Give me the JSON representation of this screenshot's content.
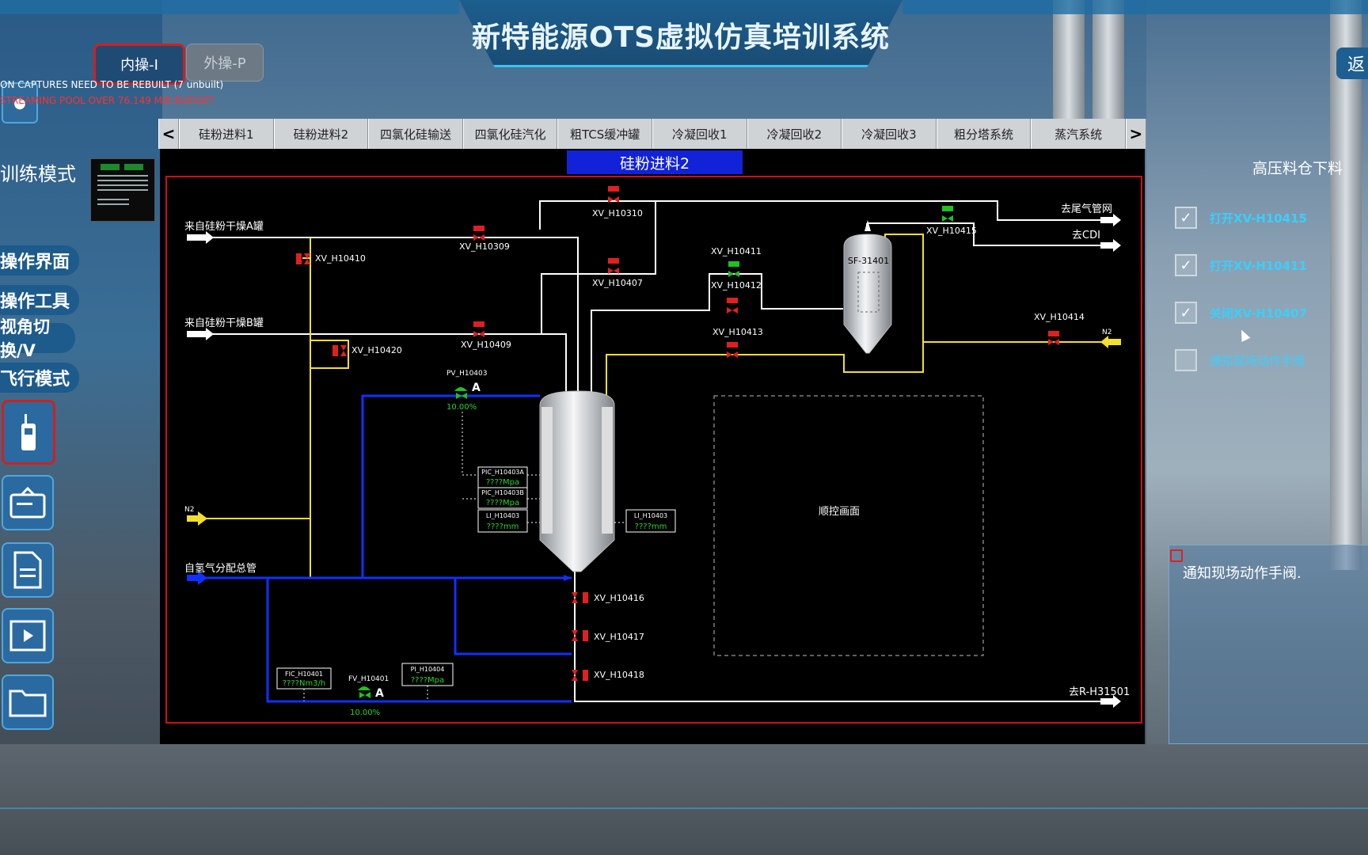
{
  "app": {
    "title": "新特能源OTS虚拟仿真培训系统"
  },
  "mode_tabs": {
    "inner": "内操-I",
    "outer": "外操-P"
  },
  "debug": {
    "line1": "ON CAPTURES NEED TO BE REBUILT (7 unbuilt)",
    "line2": "STREAMING POOL OVER 76.149 MiB BUDGET"
  },
  "left_menu": {
    "training_mode": "训练模式",
    "items": [
      "操作界面",
      "操作工具",
      "视角切换/V",
      "飞行模式"
    ],
    "icons": [
      "walkie-talkie-icon",
      "briefcase-icon",
      "document-icon",
      "video-icon",
      "folder-icon"
    ]
  },
  "tabs": {
    "prev": "<",
    "next": ">",
    "items": [
      "硅粉进料1",
      "硅粉进料2",
      "四氯化硅输送",
      "四氯化硅汽化",
      "粗TCS缓冲罐",
      "冷凝回收1",
      "冷凝回收2",
      "冷凝回收3",
      "粗分塔系统",
      "蒸汽系统"
    ]
  },
  "dcs": {
    "title": "硅粉进料2",
    "sources": {
      "dryer_a": "来自硅粉干燥A罐",
      "dryer_b": "来自硅粉干燥B罐",
      "n2_left": "N2",
      "n2_right": "N2",
      "hydrogen": "自氢气分配总管"
    },
    "destinations": {
      "tail_gas": "去尾气管网",
      "cdi": "去CDI",
      "r_h31501": "去R-H31501"
    },
    "valves": {
      "h10310": "XV_H10310",
      "h10309": "XV_H10309",
      "h10410": "XV_H10410",
      "h10407": "XV_H10407",
      "h10411": "XV_H10411",
      "h10412": "XV_H10412",
      "h10413": "XV_H10413",
      "h10415": "XV_H10415",
      "h10414": "XV_H10414",
      "h10409": "XV_H10409",
      "h10420": "XV_H10420",
      "h10416": "XV_H10416",
      "h10417": "XV_H10417",
      "h10418": "XV_H10418"
    },
    "control_valves": {
      "pv": {
        "tag": "PV_H10403",
        "mode": "A",
        "value": "10.00%"
      },
      "fv": {
        "tag": "FV_H10401",
        "mode": "A",
        "value": "10.00%"
      }
    },
    "filter": "SF-31401",
    "instruments": {
      "pic_a": {
        "tag": "PIC_H10403A",
        "value": "????Mpa"
      },
      "pic_b": {
        "tag": "PIC_H10403B",
        "value": "????Mpa"
      },
      "li_left": {
        "tag": "LI_H10403",
        "value": "????mm"
      },
      "li_right": {
        "tag": "LI_H10403",
        "value": "????mm"
      },
      "fic": {
        "tag": "FIC_H10401",
        "value": "????Nm3/h"
      },
      "pi": {
        "tag": "PI_H10404",
        "value": "????Mpa"
      }
    },
    "sequence_label": "顺控画面",
    "colors": {
      "yellow": "#f2e02a",
      "blue": "#1030ff",
      "white": "#ffffff",
      "red_valve": "#e02020",
      "green_valve": "#20c020",
      "frame": "#d01010"
    }
  },
  "right_panel": {
    "title": "高压料仓下料",
    "tasks": [
      {
        "label": "打开XV-H10415",
        "checked": true
      },
      {
        "label": "打开XV-H10411",
        "checked": true
      },
      {
        "label": "关闭XV-H10407",
        "checked": true
      },
      {
        "label": "通知现场动作手阀",
        "checked": false
      }
    ],
    "message": "通知现场动作手阀.",
    "back_button": "返"
  }
}
